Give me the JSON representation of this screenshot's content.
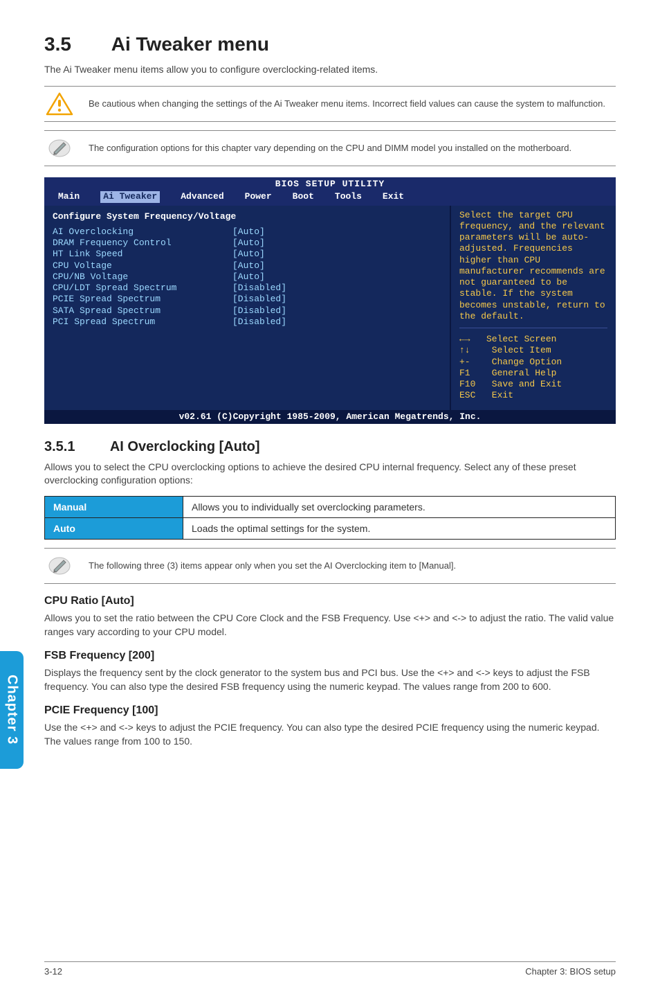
{
  "heading": {
    "number": "3.5",
    "title": "Ai Tweaker menu"
  },
  "intro": "The Ai Tweaker menu items allow you to configure overclocking-related items.",
  "callout_warn": "Be cautious when changing the settings of the Ai Tweaker menu items. Incorrect field values can cause the system to malfunction.",
  "callout_note1": "The configuration options for this chapter vary depending on the CPU and DIMM model you installed on the motherboard.",
  "bios": {
    "title": "BIOS SETUP UTILITY",
    "tabs": [
      "Main",
      "Ai Tweaker",
      "Advanced",
      "Power",
      "Boot",
      "Tools",
      "Exit"
    ],
    "section_head": "Configure System Frequency/Voltage",
    "rows": [
      {
        "k": "AI Overclocking",
        "v": "[Auto]"
      },
      {
        "k": "DRAM Frequency Control",
        "v": "[Auto]"
      },
      {
        "k": "HT Link Speed",
        "v": "[Auto]"
      },
      {
        "k": "CPU Voltage",
        "v": "[Auto]"
      },
      {
        "k": "CPU/NB Voltage",
        "v": "[Auto]"
      },
      {
        "k": "CPU/LDT Spread Spectrum",
        "v": "[Disabled]"
      },
      {
        "k": "PCIE Spread Spectrum",
        "v": "[Disabled]"
      },
      {
        "k": "SATA Spread Spectrum",
        "v": "[Disabled]"
      },
      {
        "k": "PCI Spread Spectrum",
        "v": "[Disabled]"
      }
    ],
    "help": "Select the target CPU frequency, and the relevant parameters will be auto-adjusted. Frequencies higher than CPU manufacturer recommends are not guaranteed to be stable. If the system becomes unstable, return to the default.",
    "legend": "←→   Select Screen\n↑↓    Select Item\n+-    Change Option\nF1    General Help\nF10   Save and Exit\nESC   Exit",
    "footer": "v02.61 (C)Copyright 1985-2009, American Megatrends, Inc."
  },
  "sub1": {
    "number": "3.5.1",
    "title": "AI Overclocking [Auto]",
    "para": "Allows you to select the CPU overclocking options to achieve the desired CPU internal frequency. Select any of these preset overclocking configuration options:",
    "table": [
      {
        "k": "Manual",
        "v": "Allows you to individually set overclocking parameters."
      },
      {
        "k": "Auto",
        "v": "Loads the optimal settings for the system."
      }
    ],
    "note": "The following three (3) items appear only when you set the AI Overclocking item to [Manual]."
  },
  "cpu_ratio": {
    "title": "CPU Ratio [Auto]",
    "para": "Allows you to set the ratio between the CPU Core Clock and the FSB Frequency. Use <+> and <-> to adjust the ratio. The valid value ranges vary according to your CPU model."
  },
  "fsb": {
    "title": "FSB Frequency [200]",
    "para": "Displays the frequency sent by the clock generator to the system bus and PCI bus. Use the <+> and <-> keys to adjust the FSB frequency. You can also type the desired FSB frequency using the numeric keypad. The values range from 200 to 600."
  },
  "pcie": {
    "title": "PCIE Frequency [100]",
    "para": "Use the <+> and <-> keys to adjust the PCIE frequency. You can also type the desired PCIE frequency using the numeric keypad. The values range from 100 to 150."
  },
  "sidetab": "Chapter 3",
  "footer": {
    "left": "3-12",
    "right": "Chapter 3: BIOS setup"
  }
}
